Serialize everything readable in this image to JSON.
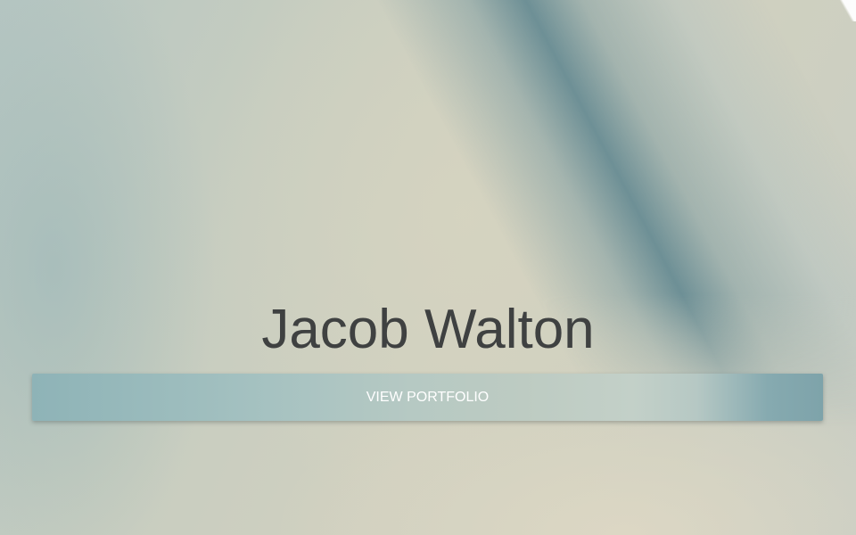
{
  "hero": {
    "name": "Jacob Walton",
    "cta_label": "VIEW PORTFOLIO"
  },
  "colors": {
    "name_text": "#3f4141",
    "button_text": "#ffffff",
    "button_accent": "#8eb3b7",
    "background": "#c9cfc3"
  }
}
